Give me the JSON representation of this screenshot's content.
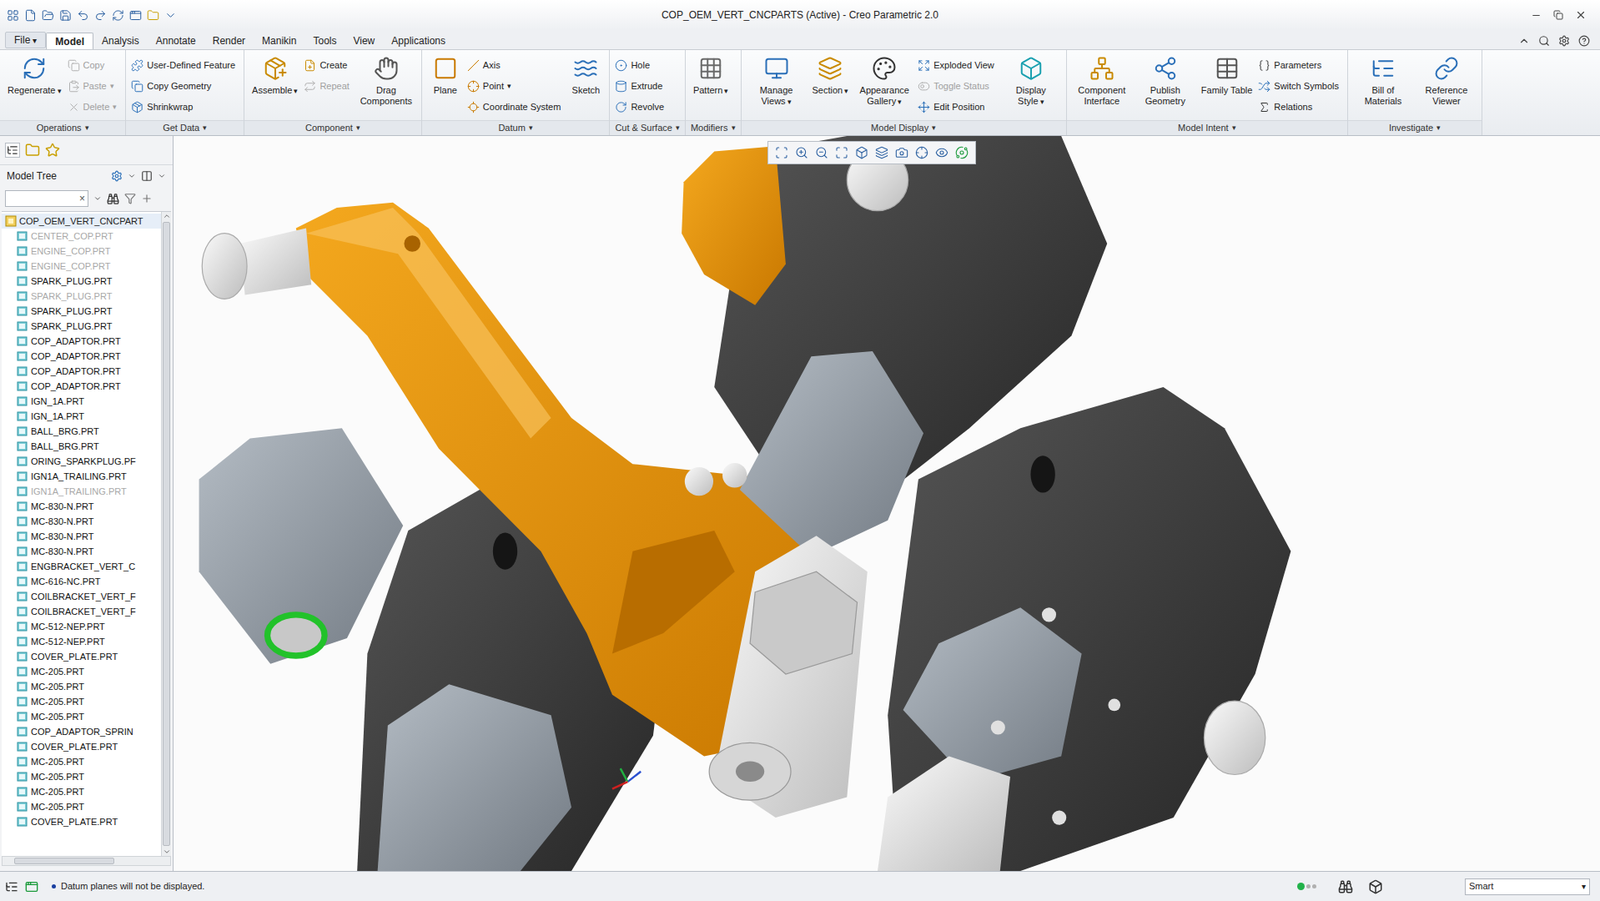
{
  "window": {
    "title": "COP_OEM_VERT_CNCPARTS (Active) - Creo Parametric 2.0"
  },
  "caret": "▾",
  "menu_tabs": [
    {
      "label": "File",
      "selected": false,
      "menu": true
    },
    {
      "label": "Model",
      "selected": true,
      "menu": false
    },
    {
      "label": "Analysis",
      "selected": false,
      "menu": false
    },
    {
      "label": "Annotate",
      "selected": false,
      "menu": false
    },
    {
      "label": "Render",
      "selected": false,
      "menu": false
    },
    {
      "label": "Manikin",
      "selected": false,
      "menu": false
    },
    {
      "label": "Tools",
      "selected": false,
      "menu": false
    },
    {
      "label": "View",
      "selected": false,
      "menu": false
    },
    {
      "label": "Applications",
      "selected": false,
      "menu": false
    }
  ],
  "ribbon": {
    "groups": [
      {
        "label": "Operations",
        "menu": true,
        "items": [
          {
            "label": "Regenerate",
            "kind": "large",
            "disabled": false,
            "menu": true
          },
          {
            "label": "Copy",
            "kind": "small",
            "disabled": true,
            "menu": false
          },
          {
            "label": "Paste",
            "kind": "small",
            "disabled": true,
            "menu": true
          },
          {
            "label": "Delete",
            "kind": "small",
            "disabled": true,
            "menu": true
          }
        ]
      },
      {
        "label": "Get Data",
        "menu": true,
        "items": [
          {
            "label": "User-Defined Feature",
            "kind": "small",
            "disabled": false,
            "menu": false
          },
          {
            "label": "Copy Geometry",
            "kind": "small",
            "disabled": false,
            "menu": false
          },
          {
            "label": "Shrinkwrap",
            "kind": "small",
            "disabled": false,
            "menu": false
          }
        ]
      },
      {
        "label": "Component",
        "menu": true,
        "items": [
          {
            "label": "Assemble",
            "kind": "large",
            "disabled": false,
            "menu": true
          },
          {
            "label": "Create",
            "kind": "small",
            "disabled": false,
            "menu": false
          },
          {
            "label": "Repeat",
            "kind": "small",
            "disabled": true,
            "menu": false
          },
          {
            "label": "Drag Components",
            "kind": "large",
            "disabled": false,
            "menu": false
          }
        ]
      },
      {
        "label": "Datum",
        "menu": true,
        "items": [
          {
            "label": "Plane",
            "kind": "large",
            "disabled": false,
            "menu": false
          },
          {
            "label": "Axis",
            "kind": "small",
            "disabled": false,
            "menu": false
          },
          {
            "label": "Point",
            "kind": "small",
            "disabled": false,
            "menu": true
          },
          {
            "label": "Coordinate System",
            "kind": "small",
            "disabled": false,
            "menu": false
          },
          {
            "label": "Sketch",
            "kind": "large",
            "disabled": false,
            "menu": false
          }
        ]
      },
      {
        "label": "Cut & Surface",
        "menu": true,
        "items": [
          {
            "label": "Hole",
            "kind": "small",
            "disabled": false,
            "menu": false
          },
          {
            "label": "Extrude",
            "kind": "small",
            "disabled": false,
            "menu": false
          },
          {
            "label": "Revolve",
            "kind": "small",
            "disabled": false,
            "menu": false
          }
        ]
      },
      {
        "label": "Modifiers",
        "menu": true,
        "items": [
          {
            "label": "Pattern",
            "kind": "large",
            "disabled": false,
            "menu": true
          }
        ]
      },
      {
        "label": "Model Display",
        "menu": true,
        "items": [
          {
            "label": "Manage Views",
            "kind": "large",
            "disabled": false,
            "menu": true
          },
          {
            "label": "Section",
            "kind": "large",
            "disabled": false,
            "menu": true
          },
          {
            "label": "Appearance Gallery",
            "kind": "large",
            "disabled": false,
            "menu": true
          },
          {
            "label": "Exploded View",
            "kind": "small",
            "disabled": false,
            "menu": false
          },
          {
            "label": "Toggle Status",
            "kind": "small",
            "disabled": true,
            "menu": false
          },
          {
            "label": "Edit Position",
            "kind": "small",
            "disabled": false,
            "menu": false
          },
          {
            "label": "Display Style",
            "kind": "large",
            "disabled": false,
            "menu": true
          }
        ]
      },
      {
        "label": "Model Intent",
        "menu": true,
        "items": [
          {
            "label": "Component Interface",
            "kind": "large",
            "disabled": false,
            "menu": false
          },
          {
            "label": "Publish Geometry",
            "kind": "large",
            "disabled": false,
            "menu": false
          },
          {
            "label": "Family Table",
            "kind": "large",
            "disabled": false,
            "menu": false
          },
          {
            "label": "Parameters",
            "kind": "small",
            "disabled": false,
            "menu": false
          },
          {
            "label": "Switch Symbols",
            "kind": "small",
            "disabled": false,
            "menu": false
          },
          {
            "label": "Relations",
            "kind": "small",
            "disabled": false,
            "menu": false
          }
        ]
      },
      {
        "label": "Investigate",
        "menu": true,
        "items": [
          {
            "label": "Bill of Materials",
            "kind": "large",
            "disabled": false,
            "menu": false
          },
          {
            "label": "Reference Viewer",
            "kind": "large",
            "disabled": false,
            "menu": false
          }
        ]
      }
    ]
  },
  "model_tree": {
    "title": "Model Tree",
    "search": {
      "value": "",
      "clear": "×"
    },
    "root": "COP_OEM_VERT_CNCPART",
    "items": [
      {
        "label": "CENTER_COP.PRT",
        "disabled": true
      },
      {
        "label": "ENGINE_COP.PRT",
        "disabled": true
      },
      {
        "label": "ENGINE_COP.PRT",
        "disabled": true
      },
      {
        "label": "SPARK_PLUG.PRT",
        "disabled": false
      },
      {
        "label": "SPARK_PLUG.PRT",
        "disabled": true
      },
      {
        "label": "SPARK_PLUG.PRT",
        "disabled": false
      },
      {
        "label": "SPARK_PLUG.PRT",
        "disabled": false
      },
      {
        "label": "COP_ADAPTOR.PRT",
        "disabled": false
      },
      {
        "label": "COP_ADAPTOR.PRT",
        "disabled": false
      },
      {
        "label": "COP_ADAPTOR.PRT",
        "disabled": false
      },
      {
        "label": "COP_ADAPTOR.PRT",
        "disabled": false
      },
      {
        "label": "IGN_1A.PRT",
        "disabled": false
      },
      {
        "label": "IGN_1A.PRT",
        "disabled": false
      },
      {
        "label": "BALL_BRG.PRT",
        "disabled": false
      },
      {
        "label": "BALL_BRG.PRT",
        "disabled": false
      },
      {
        "label": "ORING_SPARKPLUG.PF",
        "disabled": false
      },
      {
        "label": "IGN1A_TRAILING.PRT",
        "disabled": false
      },
      {
        "label": "IGN1A_TRAILING.PRT",
        "disabled": true
      },
      {
        "label": "MC-830-N.PRT",
        "disabled": false
      },
      {
        "label": "MC-830-N.PRT",
        "disabled": false
      },
      {
        "label": "MC-830-N.PRT",
        "disabled": false
      },
      {
        "label": "MC-830-N.PRT",
        "disabled": false
      },
      {
        "label": "ENGBRACKET_VERT_C",
        "disabled": false
      },
      {
        "label": "MC-616-NC.PRT",
        "disabled": false
      },
      {
        "label": "COILBRACKET_VERT_F",
        "disabled": false
      },
      {
        "label": "COILBRACKET_VERT_F",
        "disabled": false
      },
      {
        "label": "MC-512-NEP.PRT",
        "disabled": false
      },
      {
        "label": "MC-512-NEP.PRT",
        "disabled": false
      },
      {
        "label": "COVER_PLATE.PRT",
        "disabled": false
      },
      {
        "label": "MC-205.PRT",
        "disabled": false
      },
      {
        "label": "MC-205.PRT",
        "disabled": false
      },
      {
        "label": "MC-205.PRT",
        "disabled": false
      },
      {
        "label": "MC-205.PRT",
        "disabled": false
      },
      {
        "label": "COP_ADAPTOR_SPRIN",
        "disabled": false
      },
      {
        "label": "COVER_PLATE.PRT",
        "disabled": false
      },
      {
        "label": "MC-205.PRT",
        "disabled": false
      },
      {
        "label": "MC-205.PRT",
        "disabled": false
      },
      {
        "label": "MC-205.PRT",
        "disabled": false
      },
      {
        "label": "MC-205.PRT",
        "disabled": false
      },
      {
        "label": "COVER_PLATE.PRT",
        "disabled": false
      }
    ]
  },
  "status_bar": {
    "message": "Datum planes will not be displayed.",
    "selection_filter": "Smart"
  }
}
